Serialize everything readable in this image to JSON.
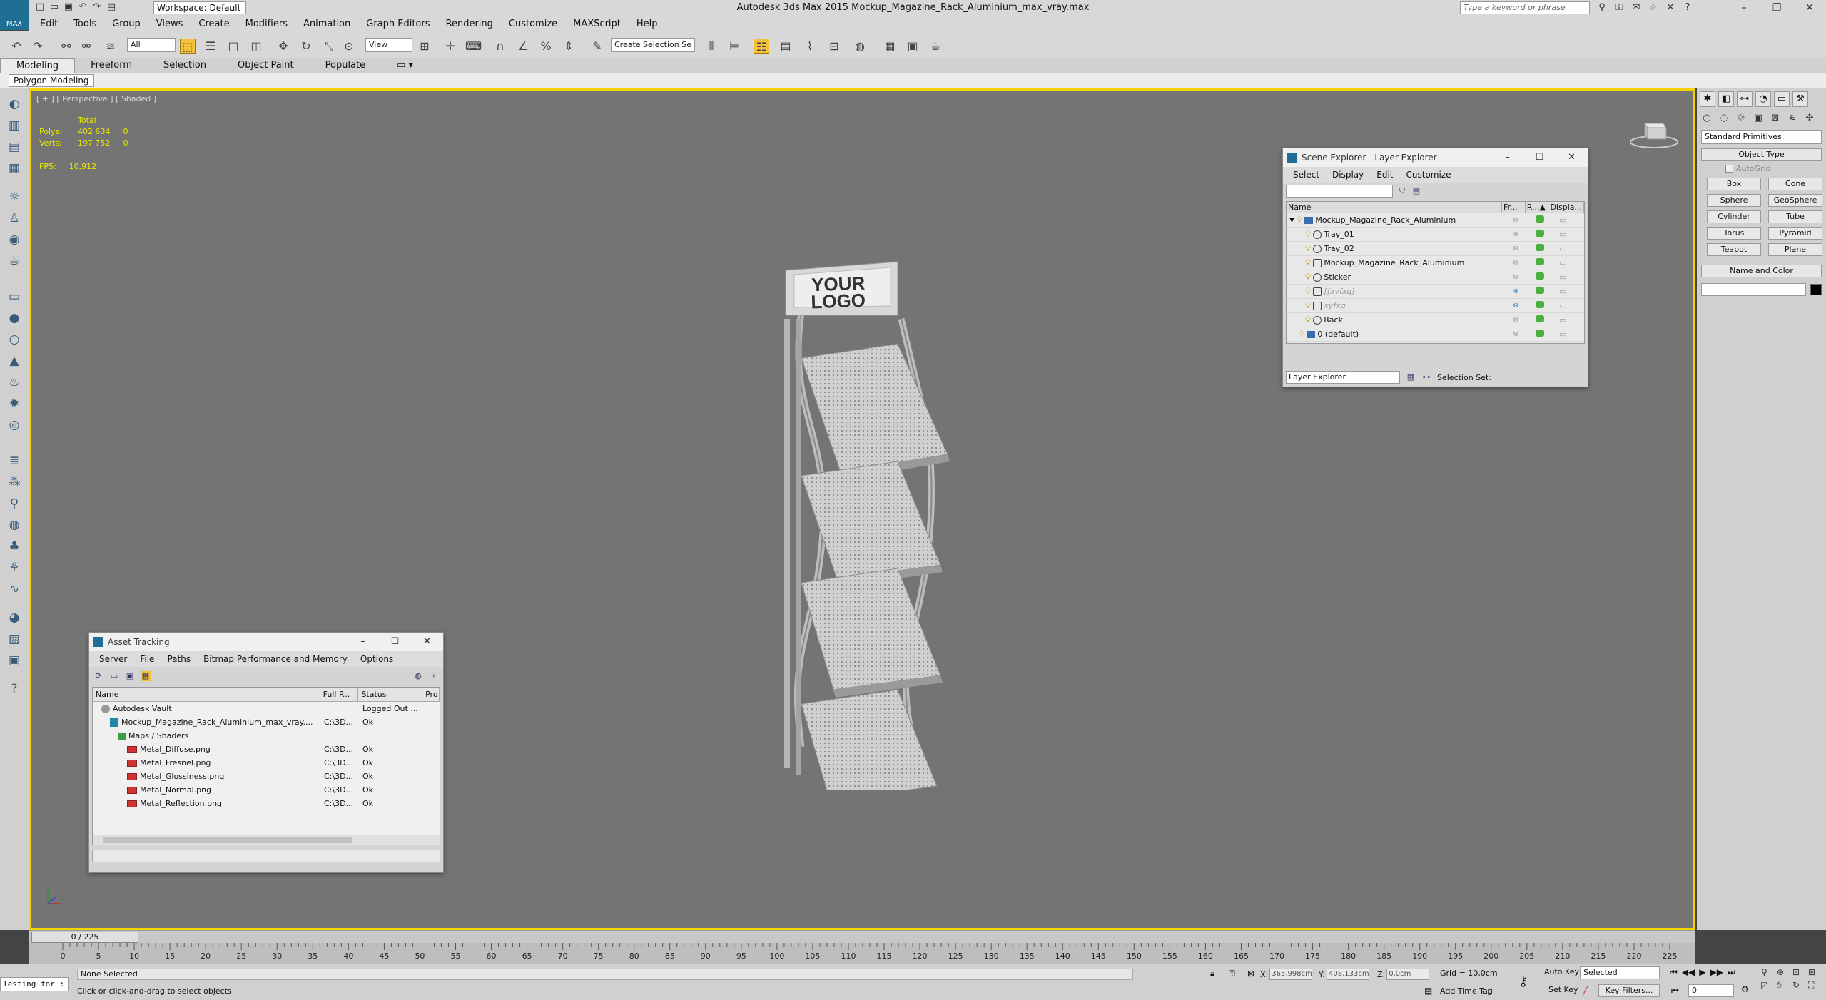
{
  "titlebar": {
    "logo": "MAX",
    "workspace": "Workspace: Default",
    "app_title": "Autodesk 3ds Max  2015     Mockup_Magazine_Rack_Aluminium_max_vray.max",
    "search_placeholder": "Type a keyword or phrase"
  },
  "menu": [
    "Edit",
    "Tools",
    "Group",
    "Views",
    "Create",
    "Modifiers",
    "Animation",
    "Graph Editors",
    "Rendering",
    "Customize",
    "MAXScript",
    "Help"
  ],
  "toolbar": {
    "filter": "All",
    "refcoord": "View",
    "selection_set": "Create Selection Se"
  },
  "ribbon": {
    "tabs": [
      "Modeling",
      "Freeform",
      "Selection",
      "Object Paint",
      "Populate"
    ],
    "sub_label": "Polygon Modeling"
  },
  "viewport": {
    "label": "[ + ] [ Perspective ] [ Shaded ]",
    "stats_header": "Total",
    "polys_label": "Polys:",
    "polys_total": "402 634",
    "polys_sel": "0",
    "verts_label": "Verts:",
    "verts_total": "197 752",
    "verts_sel": "0",
    "fps_label": "FPS:",
    "fps_value": "10,912",
    "logo_line1": "YOUR",
    "logo_line2": "LOGO"
  },
  "command_panel": {
    "category": "Standard Primitives",
    "object_type": "Object Type",
    "autogrid": "AutoGrid",
    "primitives": [
      "Box",
      "Cone",
      "Sphere",
      "GeoSphere",
      "Cylinder",
      "Tube",
      "Torus",
      "Pyramid",
      "Teapot",
      "Plane"
    ],
    "name_and_color": "Name and Color"
  },
  "scene_explorer": {
    "title": "Scene Explorer - Layer Explorer",
    "menu": [
      "Select",
      "Display",
      "Edit",
      "Customize"
    ],
    "columns": [
      "Name",
      "Fr...",
      "R...▲",
      "Displa..."
    ],
    "rows": [
      {
        "name": "Mockup_Magazine_Rack_Aluminium",
        "indent": 0,
        "kind": "layer",
        "frozen": false
      },
      {
        "name": "Tray_01",
        "indent": 1,
        "kind": "geo",
        "frozen": false
      },
      {
        "name": "Tray_02",
        "indent": 1,
        "kind": "geo",
        "frozen": false
      },
      {
        "name": "Mockup_Magazine_Rack_Aluminium",
        "indent": 1,
        "kind": "group",
        "frozen": false
      },
      {
        "name": "Sticker",
        "indent": 1,
        "kind": "geo",
        "frozen": false
      },
      {
        "name": "[[xyfxq]",
        "indent": 1,
        "kind": "group",
        "frozen": true
      },
      {
        "name": "xyfxq",
        "indent": 1,
        "kind": "group",
        "frozen": true
      },
      {
        "name": "Rack",
        "indent": 1,
        "kind": "geo",
        "frozen": false
      },
      {
        "name": "0 (default)",
        "indent": 0,
        "kind": "layer",
        "frozen": false
      }
    ],
    "bottom_dropdown": "Layer Explorer",
    "selection_set": "Selection Set:"
  },
  "asset_tracking": {
    "title": "Asset Tracking",
    "menu": [
      "Server",
      "File",
      "Paths",
      "Bitmap Performance and Memory",
      "Options"
    ],
    "columns": [
      "Name",
      "Full P...",
      "Status",
      "Pro"
    ],
    "rows": [
      {
        "name": "Autodesk Vault",
        "indent": 1,
        "icon": "vault",
        "path": "",
        "status": "Logged Out ..."
      },
      {
        "name": "Mockup_Magazine_Rack_Aluminium_max_vray....",
        "indent": 2,
        "icon": "max",
        "path": "C:\\3D...",
        "status": "Ok"
      },
      {
        "name": "Maps / Shaders",
        "indent": 3,
        "icon": "maps",
        "path": "",
        "status": ""
      },
      {
        "name": "Metal_Diffuse.png",
        "indent": 4,
        "icon": "bitmap",
        "path": "C:\\3D...",
        "status": "Ok"
      },
      {
        "name": "Metal_Fresnel.png",
        "indent": 4,
        "icon": "bitmap",
        "path": "C:\\3D...",
        "status": "Ok"
      },
      {
        "name": "Metal_Glossiness.png",
        "indent": 4,
        "icon": "bitmap",
        "path": "C:\\3D...",
        "status": "Ok"
      },
      {
        "name": "Metal_Normal.png",
        "indent": 4,
        "icon": "bitmap",
        "path": "C:\\3D...",
        "status": "Ok"
      },
      {
        "name": "Metal_Reflection.png",
        "indent": 4,
        "icon": "bitmap",
        "path": "C:\\3D...",
        "status": "Ok"
      }
    ]
  },
  "timeline": {
    "frame": "0 / 225",
    "ticks": [
      "0",
      "5",
      "10",
      "15",
      "20",
      "25",
      "30",
      "35",
      "40",
      "45",
      "50",
      "55",
      "60",
      "65",
      "70",
      "75",
      "80",
      "85",
      "90",
      "95",
      "100",
      "105",
      "110",
      "115",
      "120",
      "125",
      "130",
      "135",
      "140",
      "145",
      "150",
      "155",
      "160",
      "165",
      "170",
      "175",
      "180",
      "185",
      "190",
      "195",
      "200",
      "205",
      "210",
      "215",
      "220",
      "225"
    ]
  },
  "status": {
    "maxscript": "Testing for :",
    "selection": "None Selected",
    "prompt": "Click or click-and-drag to select objects",
    "x_label": "X:",
    "x": "365,998cm",
    "y_label": "Y:",
    "y": "408,133cm",
    "z_label": "Z:",
    "z": "0,0cm",
    "grid": "Grid = 10,0cm",
    "add_time_tag": "Add Time Tag",
    "auto_key": "Auto Key",
    "set_key": "Set Key",
    "key_mode": "Selected",
    "key_filters": "Key Filters...",
    "current_frame": "0"
  }
}
